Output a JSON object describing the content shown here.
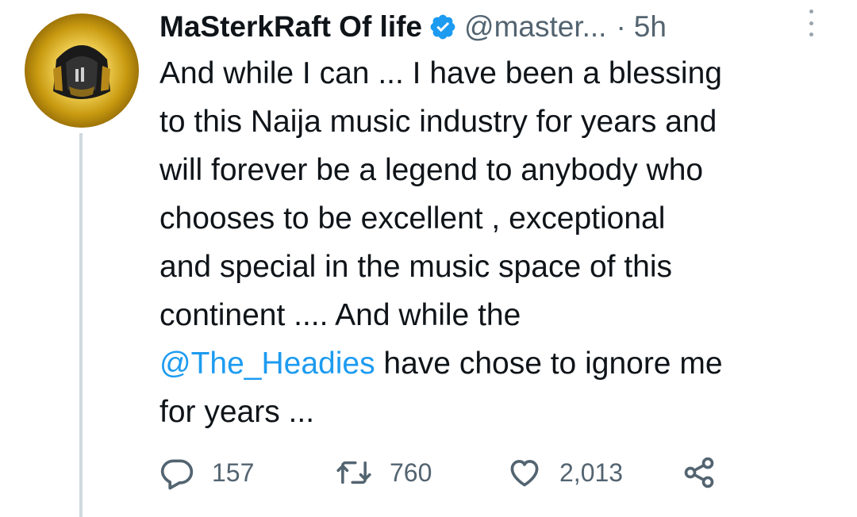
{
  "tweet": {
    "display_name": "MaSterkRaft Of life",
    "handle": "@master...",
    "separator": "·",
    "timestamp": "5h",
    "text_lines": [
      "And while I can ... I have been a blessing",
      "to this Naija music industry for years and",
      "will forever be a legend to anybody who",
      "chooses to be excellent , exceptional",
      "and special in the music space of this",
      "continent .... And while the"
    ],
    "mention": "@The_Headies",
    "mention_tail": " have chose to ignore me",
    "last_line": "for years ...",
    "replies": "157",
    "retweets": "760",
    "likes": "2,013"
  },
  "icons": {
    "verified": "verified-badge-icon",
    "more": "more-options-icon",
    "reply": "reply-icon",
    "retweet": "retweet-icon",
    "like": "heart-icon",
    "share": "share-icon"
  },
  "colors": {
    "text": "#0f1419",
    "secondary": "#536471",
    "link": "#1d9bf0",
    "thread_line": "#cfd9de",
    "avatar_gold": "#c89a10"
  }
}
